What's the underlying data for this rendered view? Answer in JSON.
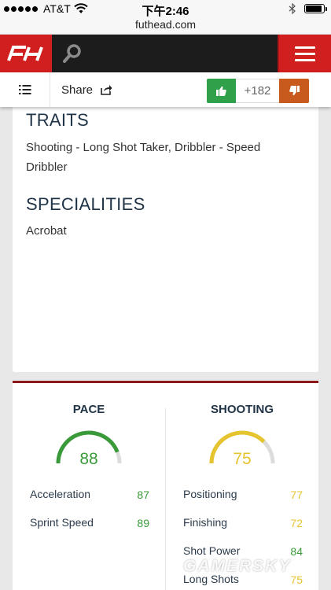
{
  "status_bar": {
    "carrier": "AT&T",
    "time": "下午2:46"
  },
  "url_bar": {
    "domain": "futhead.com"
  },
  "share_bar": {
    "share_label": "Share",
    "vote_count": "+182"
  },
  "traits": {
    "title": "TRAITS",
    "text": "Shooting - Long Shot Taker, Dribbler - Speed Dribbler"
  },
  "specialities": {
    "title": "SPECIALITIES",
    "text": "Acrobat"
  },
  "stats": {
    "pace": {
      "title": "PACE",
      "value": "88",
      "rows": [
        {
          "label": "Acceleration",
          "value": "87"
        },
        {
          "label": "Sprint Speed",
          "value": "89"
        }
      ]
    },
    "shooting": {
      "title": "SHOOTING",
      "value": "75",
      "rows": [
        {
          "label": "Positioning",
          "value": "77"
        },
        {
          "label": "Finishing",
          "value": "72"
        },
        {
          "label": "Shot Power",
          "value": "84"
        },
        {
          "label": "Long Shots",
          "value": "75"
        }
      ]
    }
  },
  "colors": {
    "brand_red": "#d11f1f",
    "stat_green": "#3a9a3a",
    "stat_yellow": "#e6c430",
    "vote_up": "#2fa14b",
    "vote_down": "#c95a1e"
  },
  "watermark": "GAMERSKY"
}
